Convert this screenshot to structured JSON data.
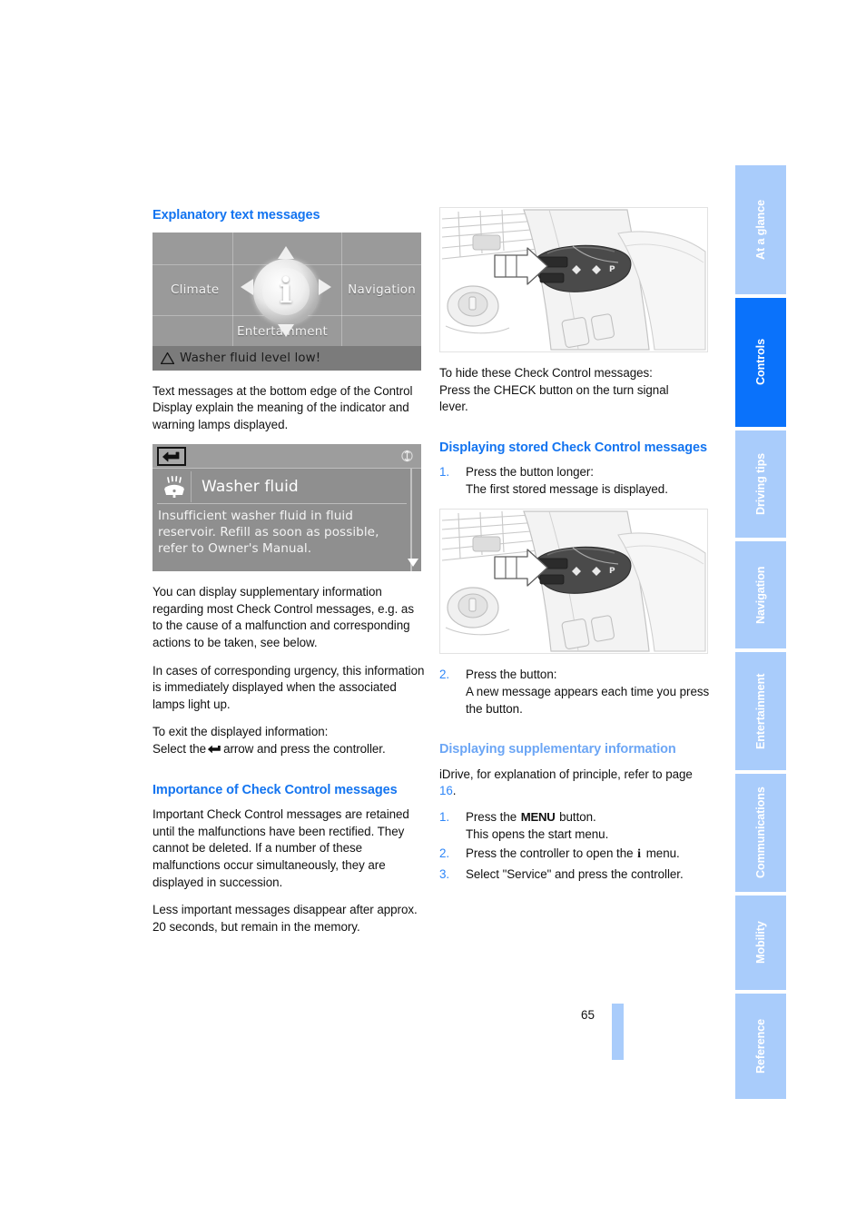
{
  "document": {
    "page_number": "65"
  },
  "left_column": {
    "heading_1": "Explanatory text messages",
    "idrive_screen": {
      "label_climate": "Climate",
      "label_navigation": "Navigation",
      "label_entertainment": "Entertainment",
      "center_icon": "info-icon",
      "status_message": "Washer fluid level low!",
      "warning_icon": "warning-triangle-icon"
    },
    "paragraph_1": "Text messages at the bottom edge of the Control Display explain the meaning of the indicator and warning lamps displayed.",
    "washer_screen": {
      "back_icon": "back-arrow-icon",
      "scroll_icon": "up-down-arrow-icon",
      "item_icon": "washer-fluid-icon",
      "title": "Washer fluid",
      "body": "Insufficient washer fluid in fluid reservoir. Refill as soon as possible, refer to Owner's Manual.",
      "scroll_down_icon": "caret-down-icon"
    },
    "paragraph_2": "You can display supplementary information regarding most Check Control messages, e.g. as to the cause of a malfunction and corresponding actions to be taken, see below.",
    "paragraph_3": "In cases of corresponding urgency, this information is immediately displayed when the associated lamps light up.",
    "paragraph_4_line1": "To exit the displayed information:",
    "paragraph_4_before_icon": "Select the",
    "paragraph_4_icon": "back-arrow-icon",
    "paragraph_4_after_icon": "arrow and press the controller.",
    "heading_2": "Importance of Check Control messages",
    "paragraph_5": "Important Check Control messages are retained until the malfunctions have been rectified. They cannot be deleted. If a number of these malfunctions occur simultaneously, they are displayed in succession.",
    "paragraph_6": "Less important messages disappear after approx. 20 seconds, but remain in the memory."
  },
  "right_column": {
    "figure_1": {
      "name": "turn-signal-lever-illustration",
      "description": "Steering column turn signal lever with arrow pointing to CHECK button"
    },
    "paragraph_1_line1": "To hide these Check Control messages:",
    "paragraph_1_line2": "Press the CHECK button on the turn signal",
    "paragraph_1_line3": "lever.",
    "heading_1": "Displaying stored Check Control messages",
    "steps_1": [
      {
        "num": "1.",
        "main": "Press the button longer:",
        "sub": "The first stored message is displayed."
      }
    ],
    "figure_2": {
      "name": "turn-signal-lever-illustration",
      "description": "Steering column turn signal lever with arrow pointing to CHECK button"
    },
    "steps_2": [
      {
        "num": "2.",
        "main": "Press the button:",
        "sub": "A new message appears each time you press the button."
      }
    ],
    "heading_2": "Displaying supplementary information",
    "paragraph_2_before": "iDrive, for explanation of principle, refer to page",
    "paragraph_2_pageref": "16",
    "paragraph_2_after": ".",
    "steps_3": [
      {
        "num": "1.",
        "main_before": "Press the",
        "main_glyph": "MENU",
        "main_after": "button.",
        "sub": "This opens the start menu."
      },
      {
        "num": "2.",
        "main_before": "Press the controller to open the",
        "main_glyph": "i",
        "main_after": "menu.",
        "sub": ""
      },
      {
        "num": "3.",
        "main_before": "Select \"Service\" and press the controller.",
        "main_glyph": "",
        "main_after": "",
        "sub": ""
      }
    ]
  },
  "tabs": [
    {
      "label": "At a glance",
      "active": false
    },
    {
      "label": "Controls",
      "active": true
    },
    {
      "label": "Driving tips",
      "active": false
    },
    {
      "label": "Navigation",
      "active": false
    },
    {
      "label": "Entertainment",
      "active": false
    },
    {
      "label": "Communications",
      "active": false
    },
    {
      "label": "Mobility",
      "active": false
    },
    {
      "label": "Reference",
      "active": false
    }
  ],
  "colors": {
    "heading_blue": "#1374F0",
    "heading_blue_light": "#6CA6F5",
    "tab_inactive": "#A9CCFB",
    "tab_active": "#0A72FB",
    "list_number_blue": "#2E86F8"
  }
}
